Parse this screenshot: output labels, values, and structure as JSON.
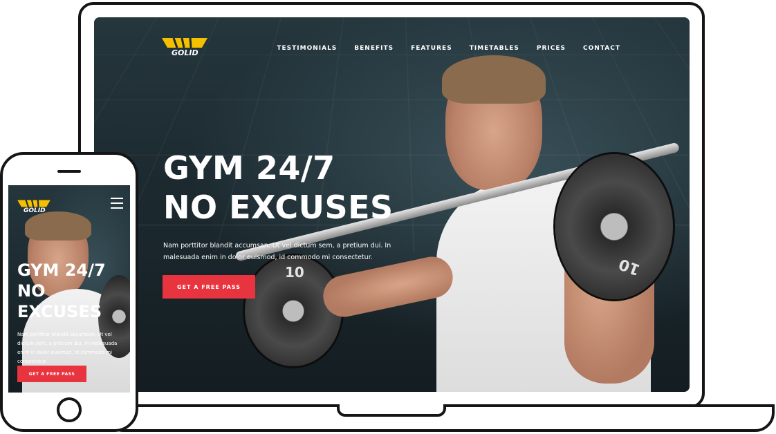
{
  "brand": {
    "name": "GOLID",
    "accent_color": "#f5c000",
    "cta_color": "#e8343f"
  },
  "nav": {
    "items": [
      "TESTIMONIALS",
      "BENEFITS",
      "FEATURES",
      "TIMETABLES",
      "PRICES",
      "CONTACT"
    ]
  },
  "hero": {
    "title_line1": "GYM 24/7",
    "title_line2": "NO EXCUSES",
    "mobile_title_line1": "GYM 24/7",
    "mobile_title_line2": "NO",
    "mobile_title_line3": "EXCUSES",
    "text": "Nam porttitor blandit accumsan. Ut vel dictum sem, a pretium dui. In malesuada enim in dolor euismod, id commodo mi consectetur.",
    "cta_label": "GET A FREE PASS"
  },
  "plates": {
    "big_number": "10",
    "small_number": "10"
  },
  "icons": {
    "mobile_menu": "hamburger-menu-icon",
    "logo": "golid-logo-icon"
  }
}
